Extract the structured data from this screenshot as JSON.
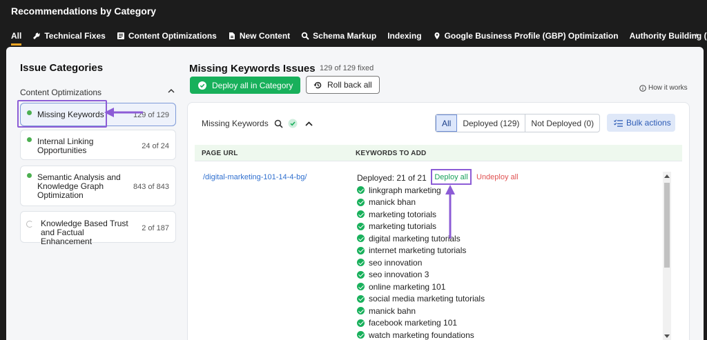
{
  "app": {
    "title": "Recommendations by Category"
  },
  "tabs": [
    {
      "label": "All",
      "icon": "none"
    },
    {
      "label": "Technical Fixes",
      "icon": "wrench-icon"
    },
    {
      "label": "Content Optimizations",
      "icon": "document-lines-icon"
    },
    {
      "label": "New Content",
      "icon": "file-icon"
    },
    {
      "label": "Schema Markup",
      "icon": "magnifier-icon"
    },
    {
      "label": "Indexing",
      "icon": "none"
    },
    {
      "label": "Google Business Profile (GBP) Optimization",
      "icon": "map-pin-icon"
    },
    {
      "label": "Authority Building (Hype",
      "icon": "none"
    }
  ],
  "sidebar": {
    "title": "Issue Categories",
    "group_title": "Content Optimizations",
    "items": [
      {
        "label": "Missing Keywords",
        "count": "129 of 129",
        "status": "done"
      },
      {
        "label": "Internal Linking Opportunities",
        "count": "24 of 24",
        "status": "done"
      },
      {
        "label": "Semantic Analysis and Knowledge Graph Optimization",
        "count": "843 of 843",
        "status": "done"
      },
      {
        "label": "Knowledge Based Trust and Factual Enhancement",
        "count": "2 of 187",
        "status": "pending"
      }
    ]
  },
  "main": {
    "title": "Missing Keywords Issues",
    "subtitle": "129 of 129 fixed",
    "deploy_category_label": "Deploy all in Category",
    "rollback_label": "Roll back all",
    "how_it_works": "How it works",
    "card": {
      "title": "Missing Keywords",
      "filters": [
        "All",
        "Deployed (129)",
        "Not Deployed (0)"
      ],
      "active_filter": "All",
      "bulk_actions": "Bulk actions",
      "columns": [
        "PAGE URL",
        "KEYWORDS TO ADD"
      ],
      "row": {
        "url": "/digital-marketing-101-14-4-bg/",
        "deployed_text": "Deployed: 21 of 21",
        "deploy_all": "Deploy all",
        "undeploy_all": "Undeploy all",
        "keywords": [
          "linkgraph marketing",
          "manick bhan",
          "marketing totorials",
          "marketing tutorials",
          "digital marketing tutorials",
          "internet marketing tutorials",
          "seo innovation",
          "seo innovation 3",
          "online marketing 101",
          "social media marketing tutorials",
          "manick bahn",
          "facebook marketing 101",
          "watch marketing foundations"
        ]
      }
    }
  },
  "colors": {
    "accent_green": "#18b05b",
    "highlight_purple": "#8c5cd6",
    "tab_underline": "#f5a623",
    "link_blue": "#2f6fcf",
    "danger_red": "#e05252"
  }
}
